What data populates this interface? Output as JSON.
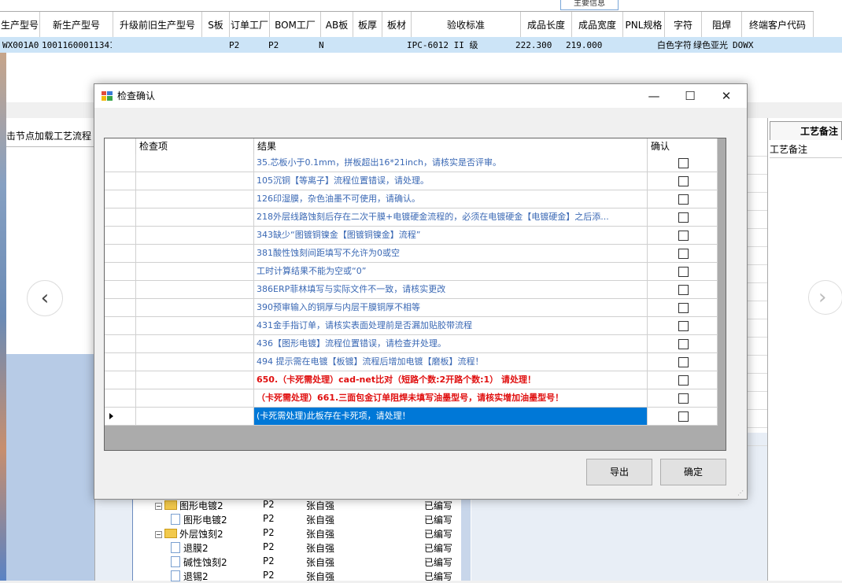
{
  "background": {
    "group_label": "主要信息",
    "columns": [
      "生产型号",
      "新生产型号",
      "升级前旧生产型号",
      "S板",
      "订单工厂",
      "BOM工厂",
      "AB板",
      "板厚",
      "板材",
      "验收标准",
      "成品长度",
      "成品宽度",
      "PNL规格",
      "字符",
      "阻焊",
      "终端客户代码"
    ],
    "row": [
      "WX001A0",
      "10011600011341",
      "",
      "",
      "P2",
      "P2",
      "N",
      "",
      "",
      "IPC-6012 II 级",
      "222.300",
      "219.000",
      "",
      "白色字符",
      "绿色亚光",
      "DOWX"
    ],
    "left_tab": "击节点加载工艺流程",
    "right_tab": "工艺备注",
    "right_sub": "工艺备注",
    "nav_prev": "‹",
    "nav_next": "›",
    "tree": [
      {
        "indent": 0,
        "type": "folder",
        "name": "图形电镀2",
        "factory": "P2",
        "person": "张自强",
        "status": "已编写"
      },
      {
        "indent": 1,
        "type": "file",
        "name": "图形电镀2",
        "factory": "P2",
        "person": "张自强",
        "status": "已编写"
      },
      {
        "indent": 0,
        "type": "folder",
        "name": "外层蚀刻2",
        "factory": "P2",
        "person": "张自强",
        "status": "已编写"
      },
      {
        "indent": 1,
        "type": "file",
        "name": "退膜2",
        "factory": "P2",
        "person": "张自强",
        "status": "已编写"
      },
      {
        "indent": 1,
        "type": "file",
        "name": "碱性蚀刻2",
        "factory": "P2",
        "person": "张自强",
        "status": "已编写"
      },
      {
        "indent": 1,
        "type": "file",
        "name": "退锡2",
        "factory": "P2",
        "person": "张自强",
        "status": "已编写"
      }
    ]
  },
  "dialog": {
    "title": "检查确认",
    "minimize": "—",
    "maximize": "☐",
    "close": "✕",
    "columns": {
      "item": "检查项",
      "result": "结果",
      "confirm": "确认"
    },
    "rows": [
      {
        "result": "35.芯板小于0.1mm，拼板超出16*21inch，请核实是否评审。",
        "style": "blue"
      },
      {
        "result": "105沉铜【等离子】流程位置错误，请处理。",
        "style": "blue"
      },
      {
        "result": "126印湿膜，杂色油墨不可使用，请确认。",
        "style": "blue"
      },
      {
        "result": "218外层线路蚀刻后存在二次干膜+电镀硬金流程的，必须在电镀硬金【电镀硬金】之后添...",
        "style": "blue"
      },
      {
        "result": "343缺少“图镀铜镍金【图镀铜镍金】流程”",
        "style": "blue"
      },
      {
        "result": "381酸性蚀刻间距填写不允许为0或空",
        "style": "blue"
      },
      {
        "result": "工时计算结果不能为空或“0”",
        "style": "blue"
      },
      {
        "result": "386ERP菲林填写与实际文件不一致，请核实更改",
        "style": "blue"
      },
      {
        "result": "390预审输入的铜厚与内层干膜铜厚不相等",
        "style": "blue"
      },
      {
        "result": "431金手指订单，请核实表面处理前是否漏加贴胶带流程",
        "style": "blue"
      },
      {
        "result": "436【图形电镀】流程位置错误，请检查并处理。",
        "style": "blue"
      },
      {
        "result": "494 提示需在电镀【板镀】流程后增加电镀【磨板】流程！",
        "style": "blue"
      },
      {
        "result": "650.（卡死需处理）cad-net比对（短路个数:2开路个数:1） 请处理！",
        "style": "red"
      },
      {
        "result": "（卡死需处理）661.三面包金订单阻焊未填写油墨型号，请核实增加油墨型号！",
        "style": "red"
      },
      {
        "result": "(卡死需处理)此板存在卡死项，请处理！",
        "style": "selected"
      }
    ],
    "export_button": "导出",
    "ok_button": "确定"
  }
}
